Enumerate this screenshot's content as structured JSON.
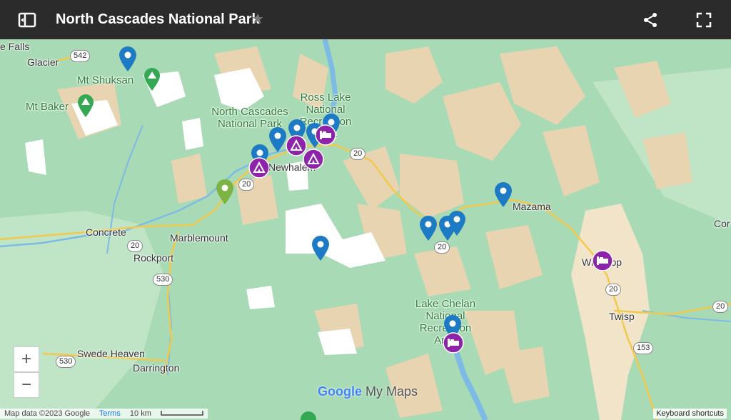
{
  "header": {
    "title": "North Cascades National Park"
  },
  "places": [
    "e Falls",
    "Glacier",
    "Concrete",
    "Marblemount",
    "Rockport",
    "Swede Heaven",
    "Darrington",
    "Newhalem",
    "Mazama",
    "Winthrop",
    "Twisp",
    "Cor"
  ],
  "parks": {
    "north_cascades": "North Cascades National Park",
    "ross_lake": "Ross Lake National Recreation Area",
    "lake_chelan": "Lake Chelan National Recreation Area"
  },
  "peaks": {
    "shuksan": "Mt Shuksan",
    "baker": "Mt Baker"
  },
  "routes": {
    "r542": "542",
    "r20a": "20",
    "r20b": "20",
    "r20c": "20",
    "r20d": "20",
    "r20e": "20",
    "r20f": "20",
    "r530": "530",
    "r530b": "530",
    "r153": "153"
  },
  "zoom": {
    "in": "+",
    "out": "−"
  },
  "brand": {
    "google": "Google",
    "mymaps": "My Maps"
  },
  "footer": {
    "map_data": "Map data ©2023 Google",
    "terms": "Terms",
    "scale": "10 km",
    "keyboard": "Keyboard shortcuts"
  },
  "colors": {
    "header_bg": "#2b2b2b",
    "map_green": "#a8dab5",
    "terrain_tan": "#e8d4b0",
    "water_blue": "#7dbbe6",
    "pin_blue": "#1d7bc5",
    "pin_purple": "#8e24aa",
    "pin_green": "#7cb342",
    "road_yellow": "#f2c94c"
  },
  "icons": {
    "menu": "panel-toggle-icon",
    "star": "star-icon",
    "share": "share-icon",
    "fullscreen": "fullscreen-icon",
    "pin": "map-pin-icon",
    "camp": "campground-icon",
    "lodging": "lodging-icon",
    "trail": "mountain-icon"
  }
}
